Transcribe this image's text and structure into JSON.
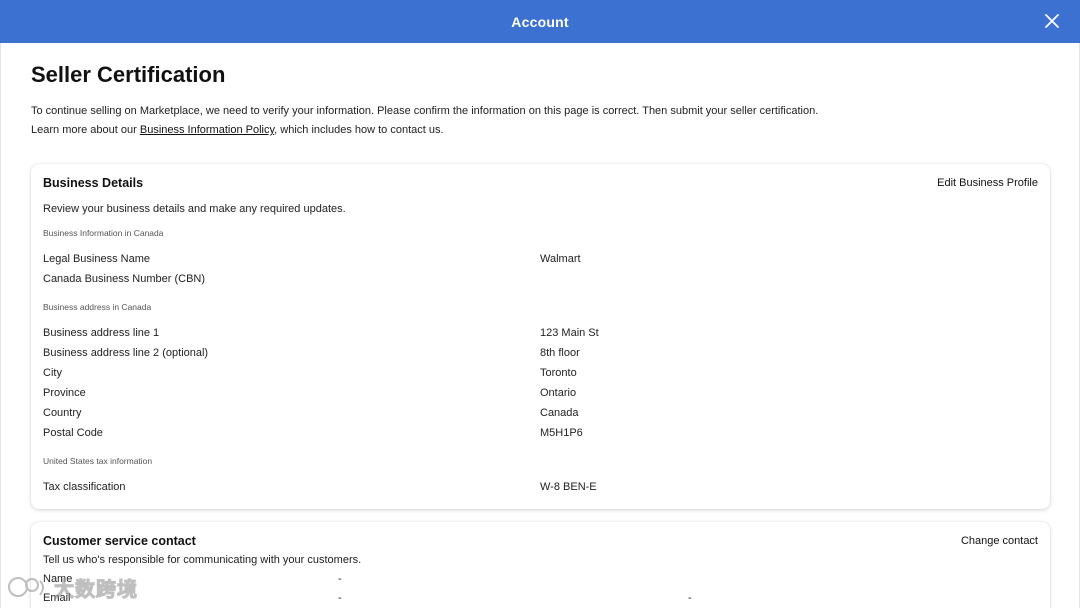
{
  "header": {
    "title": "Account"
  },
  "page": {
    "title": "Seller Certification",
    "intro_line1": "To continue selling on Marketplace, we need to verify your information. Please confirm the information on this page is correct. Then submit your seller certification.",
    "intro_line2_prefix": "Learn more about our ",
    "intro_link": "Business Information Policy",
    "intro_line2_suffix": ", which includes how to contact us."
  },
  "business_details": {
    "title": "Business Details",
    "edit_label": "Edit Business Profile",
    "description": "Review your business details and make any required updates.",
    "info_section": "Business Information in Canada",
    "info_rows": [
      {
        "label": "Legal Business Name",
        "value": "Walmart"
      },
      {
        "label": "Canada Business Number (CBN)",
        "value": ""
      }
    ],
    "address_section": "Business address in Canada",
    "address_rows": [
      {
        "label": "Business address line 1",
        "value": "123 Main St"
      },
      {
        "label": "Business address line 2 (optional)",
        "value": "8th floor"
      },
      {
        "label": "City",
        "value": "Toronto"
      },
      {
        "label": "Province",
        "value": "Ontario"
      },
      {
        "label": "Country",
        "value": "Canada"
      },
      {
        "label": "Postal Code",
        "value": "M5H1P6"
      }
    ],
    "tax_section": "United States tax information",
    "tax_rows": [
      {
        "label": "Tax classification",
        "value": "W-8 BEN-E"
      }
    ]
  },
  "customer_service": {
    "title": "Customer service contact",
    "change_label": "Change contact",
    "description": "Tell us who's responsible for communicating with your customers.",
    "rows": [
      {
        "label": "Name",
        "value": "-",
        "value2": ""
      },
      {
        "label": "Email",
        "value": "-",
        "value2": "-"
      }
    ]
  },
  "watermark": {
    "text": "大数跨境"
  },
  "colors": {
    "header_bg": "#3d71d1",
    "card_border": "#e3e3e3"
  }
}
